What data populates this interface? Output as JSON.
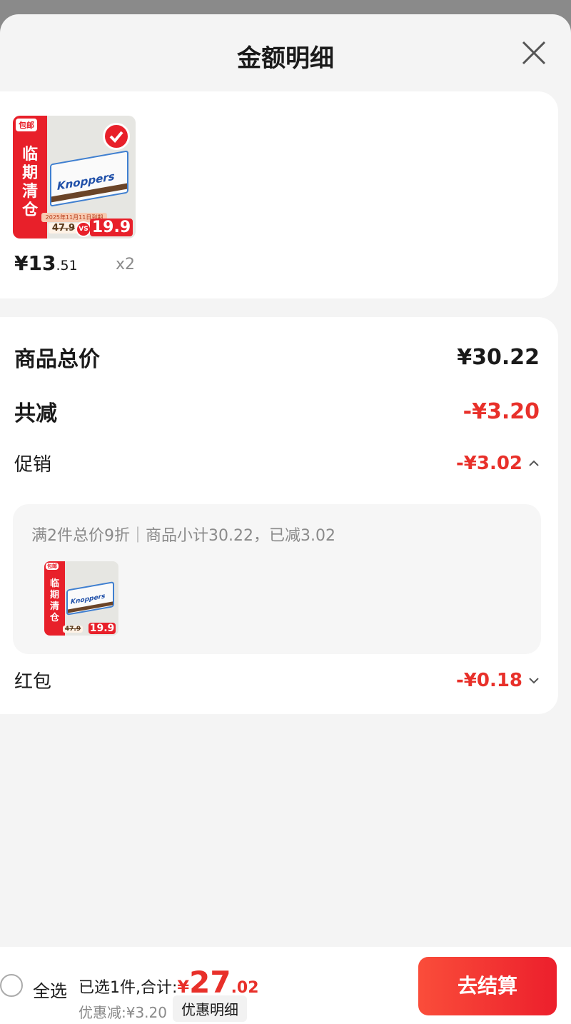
{
  "header": {
    "title": "金额明细"
  },
  "product": {
    "thumb": {
      "badge": "包邮",
      "banner_chars": [
        "临",
        "期",
        "清",
        "仓"
      ],
      "brand": "Knoppers",
      "date_strip": "2025年11月11日到期",
      "old_price": "47.9",
      "vs": "VS",
      "new_price": "19.9"
    },
    "price_symbol": "¥",
    "price_integer": "13",
    "price_decimal": ".51",
    "quantity": "x2"
  },
  "summary": {
    "total_label": "商品总价",
    "total_value": "¥30.22",
    "reduce_label": "共减",
    "reduce_value": "-¥3.20",
    "promo_label": "促销",
    "promo_value": "-¥3.02",
    "promo_detail": "满2件总价9折｜商品小计30.22，已减3.02",
    "redpack_label": "红包",
    "redpack_value": "-¥0.18"
  },
  "footer": {
    "select_all": "全选",
    "selected_text": "已选1件,合计:",
    "total_symbol": "¥",
    "total_integer": "27",
    "total_decimal": ".02",
    "discount_text": "优惠减:¥3.20",
    "detail_button": "优惠明细",
    "checkout_button": "去结算"
  },
  "colors": {
    "accent_red": "#e8302a",
    "checkout_red": "#ec1f2c",
    "sheet_bg": "#f4f4f4"
  }
}
